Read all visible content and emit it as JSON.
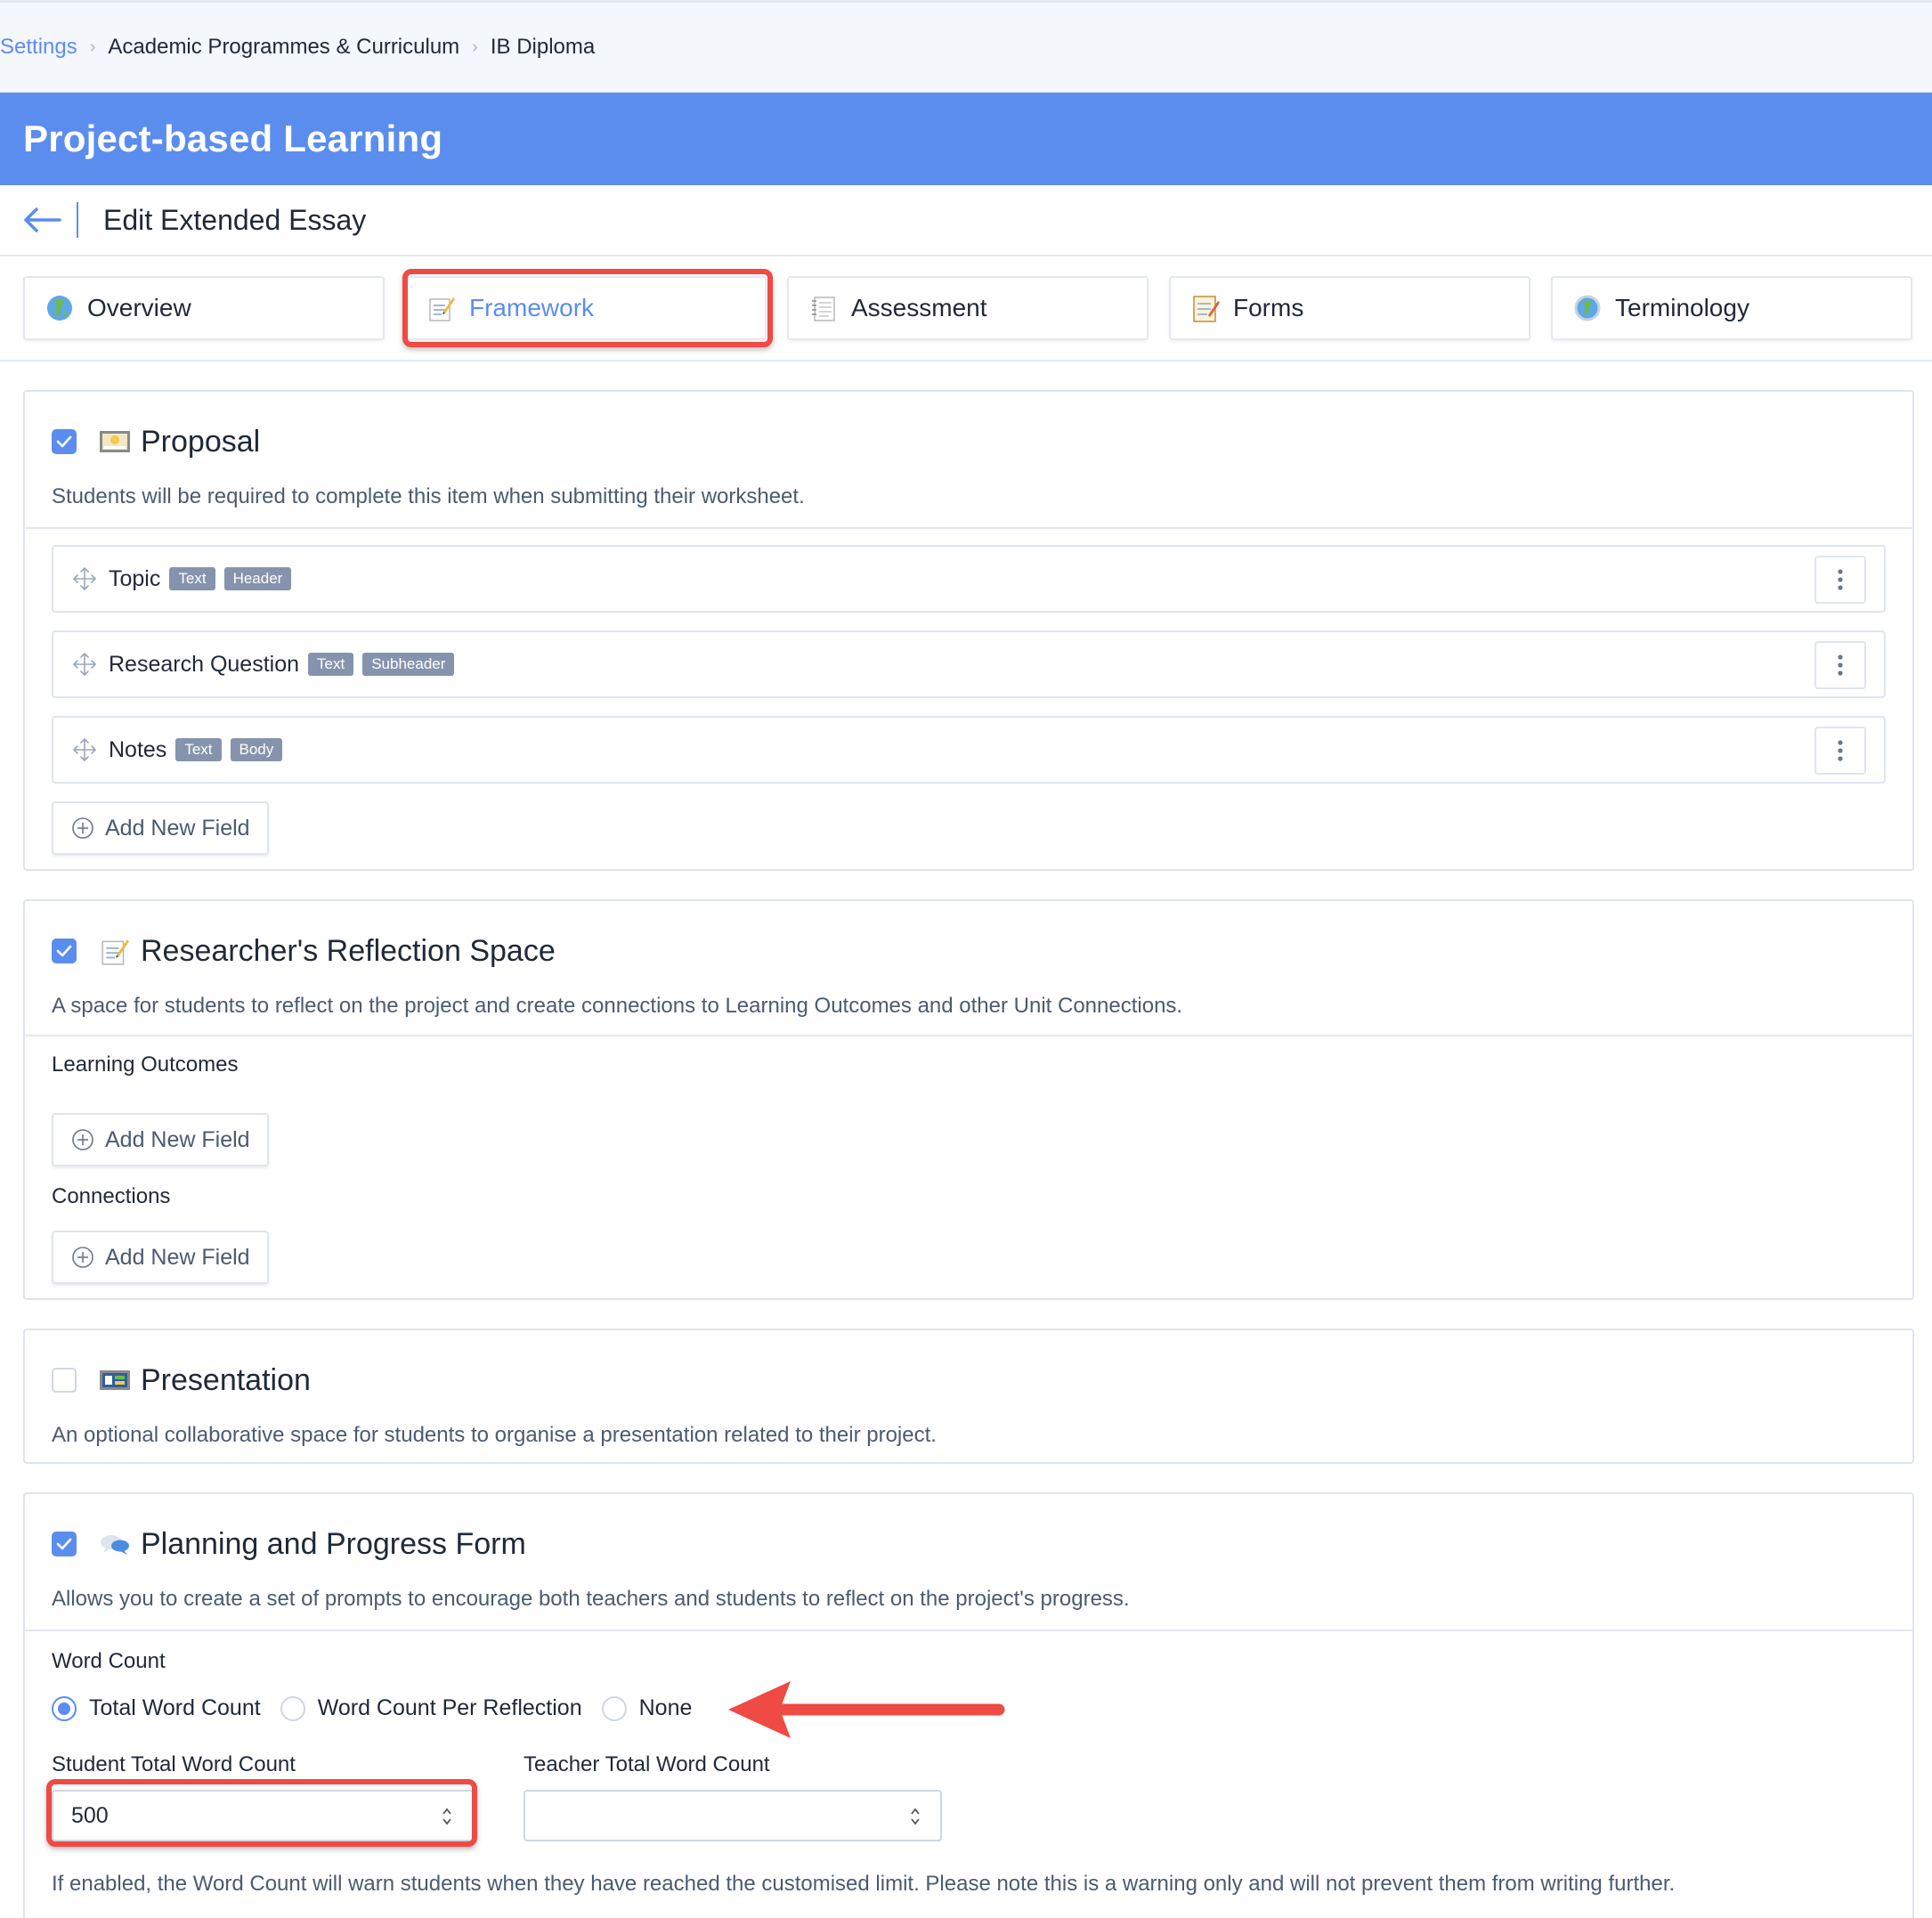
{
  "breadcrumb": {
    "items": [
      "Settings",
      "Academic Programmes & Curriculum",
      "IB Diploma"
    ]
  },
  "header": {
    "title": "Project-based Learning"
  },
  "subheader": {
    "title": "Edit Extended Essay"
  },
  "tabs": [
    {
      "label": "Overview",
      "icon": "globe-icon",
      "active": false
    },
    {
      "label": "Framework",
      "icon": "memo-icon",
      "active": true
    },
    {
      "label": "Assessment",
      "icon": "spiral-notepad-icon",
      "active": false
    },
    {
      "label": "Forms",
      "icon": "memo-pencil-icon",
      "active": false
    },
    {
      "label": "Terminology",
      "icon": "globe-meridians-icon",
      "active": false
    }
  ],
  "sections": {
    "proposal": {
      "checked": true,
      "icon": "framed-picture-icon",
      "title": "Proposal",
      "description": "Students will be required to complete this item when submitting their worksheet.",
      "fields": [
        {
          "name": "Topic",
          "badges": [
            "Text",
            "Header"
          ]
        },
        {
          "name": "Research Question",
          "badges": [
            "Text",
            "Subheader"
          ]
        },
        {
          "name": "Notes",
          "badges": [
            "Text",
            "Body"
          ]
        }
      ],
      "add_label": "Add New Field"
    },
    "reflection": {
      "checked": true,
      "icon": "memo-icon",
      "title": "Researcher's Reflection Space",
      "description": "A space for students to reflect on the project and create connections to Learning Outcomes and other Unit Connections.",
      "learning_outcomes_label": "Learning Outcomes",
      "connections_label": "Connections",
      "add_label": "Add New Field"
    },
    "presentation": {
      "checked": false,
      "icon": "presentation-board-icon",
      "title": "Presentation",
      "description": "An optional collaborative space for students to organise a presentation related to their project."
    },
    "planning": {
      "checked": true,
      "icon": "speech-bubbles-icon",
      "title": "Planning and Progress Form",
      "description": "Allows you to create a set of prompts to encourage both teachers and students to reflect on the project's progress.",
      "word_count_label": "Word Count",
      "word_count_options": [
        "Total Word Count",
        "Word Count Per Reflection",
        "None"
      ],
      "word_count_selected": "Total Word Count",
      "student_label": "Student Total Word Count",
      "student_value": "500",
      "teacher_label": "Teacher Total Word Count",
      "teacher_value": "",
      "note": "If enabled, the Word Count will warn students when they have reached the customised limit. Please note this is a warning only and will not prevent them from writing further."
    }
  },
  "colors": {
    "accent": "#5b8def",
    "annotation": "#ef4a43",
    "badge": "#8594ac"
  }
}
